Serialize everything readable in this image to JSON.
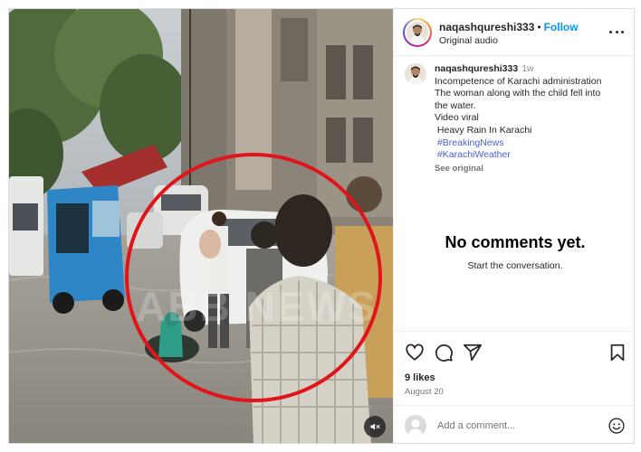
{
  "post": {
    "username": "naqashqureshi333",
    "follow_label": "Follow",
    "dot": "•",
    "audio_label": "Original audio"
  },
  "caption": {
    "username": "naqashqureshi333",
    "time": "1w",
    "lines": [
      "Incompetence of Karachi administration",
      "The woman along with the child fell into",
      "the water.",
      "Video viral",
      " Heavy Rain In Karachi"
    ],
    "hashtags": [
      "#BreakingNews",
      "#KarachiWeather"
    ],
    "see_original": "See original"
  },
  "comments": {
    "empty_title": "No comments yet.",
    "empty_subtitle": "Start the conversation."
  },
  "actions": {
    "icons": [
      "heart-icon",
      "comment-icon",
      "share-icon",
      "bookmark-icon"
    ],
    "likes": "9 likes",
    "date": "August 20"
  },
  "composer": {
    "placeholder": "Add a comment..."
  },
  "media": {
    "watermark": "ABB NEWS",
    "mute_icon": "speaker-muted-icon",
    "highlight_color": "#e0151b"
  }
}
